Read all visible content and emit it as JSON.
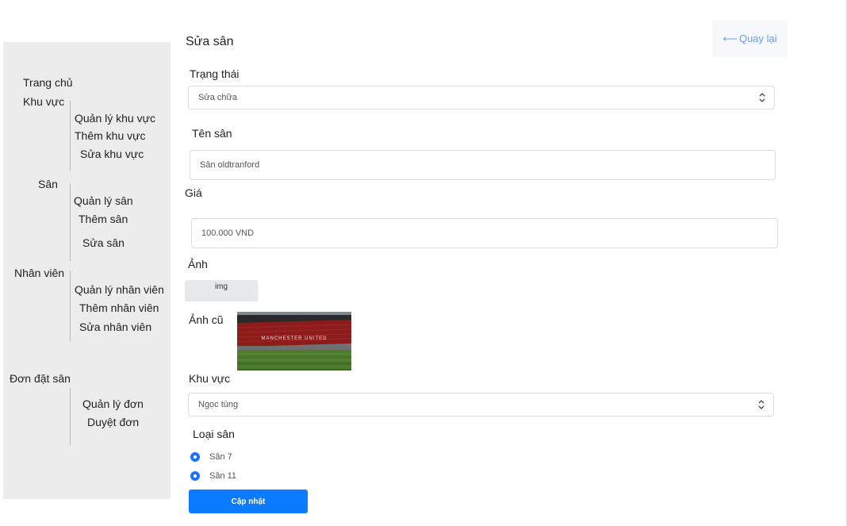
{
  "sidebar": {
    "home": "Trang chủ",
    "area": {
      "label": "Khu vực",
      "items": [
        "Quản lý khu vực",
        "Thêm khu vực",
        "Sửa khu vực"
      ]
    },
    "field": {
      "label": "Sân",
      "items": [
        "Quản lý sân",
        "Thêm sân",
        "Sửa sân"
      ]
    },
    "staff": {
      "label": "Nhân viên",
      "items": [
        "Quản lý nhân viên",
        "Thêm nhân viên",
        "Sửa nhân viên"
      ]
    },
    "booking": {
      "label": "Đơn đặt sân",
      "items": [
        "Quản lý đơn",
        "Duyệt đơn"
      ]
    }
  },
  "header": {
    "title": "Sửa sân",
    "back_label": "Quay lại",
    "back_icon": "arrow-left-icon"
  },
  "form": {
    "status": {
      "label": "Trạng thái",
      "value": "Sửa chữa"
    },
    "name": {
      "label": "Tên sân",
      "value": "Sân oldtranford"
    },
    "price": {
      "label": "Giá",
      "value": "100.000 VND"
    },
    "image": {
      "label": "Ảnh",
      "button_label": "img"
    },
    "old_image": {
      "label": "Ảnh cũ",
      "stadium_text": "MANCHESTER UNITED"
    },
    "area": {
      "label": "Khu vực",
      "value": "Ngọc tùng"
    },
    "type": {
      "label": "Loại sân",
      "options": [
        "Sân 7",
        "Sân 11"
      ]
    },
    "submit_label": "Cập nhật"
  },
  "colors": {
    "accent": "#0a7bff",
    "sidebar_bg": "#ececec",
    "back_link": "#6b9ce6"
  }
}
